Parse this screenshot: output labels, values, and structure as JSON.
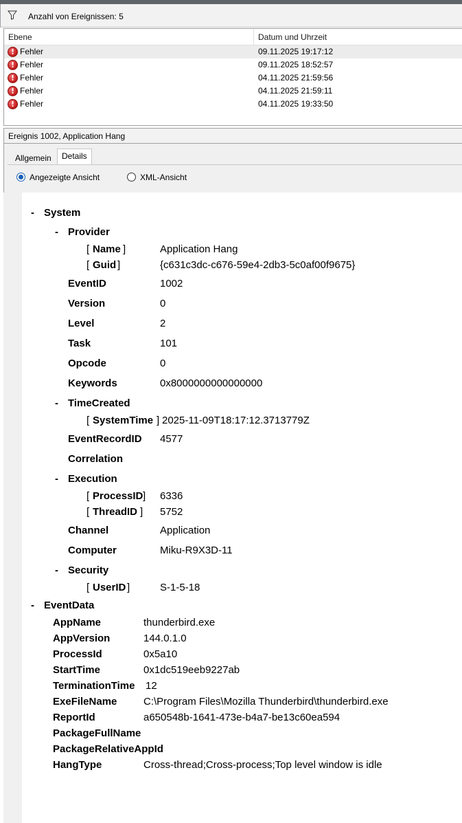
{
  "filter": {
    "count_label": "Anzahl von Ereignissen: 5"
  },
  "list": {
    "columns": [
      "Ebene",
      "Datum und Uhrzeit"
    ],
    "rows": [
      {
        "level": "Fehler",
        "datetime": "09.11.2025 19:17:12"
      },
      {
        "level": "Fehler",
        "datetime": "09.11.2025 18:52:57"
      },
      {
        "level": "Fehler",
        "datetime": "04.11.2025 21:59:56"
      },
      {
        "level": "Fehler",
        "datetime": "04.11.2025 21:59:11"
      },
      {
        "level": "Fehler",
        "datetime": "04.11.2025 19:33:50"
      }
    ]
  },
  "detail": {
    "title": "Ereignis 1002, Application Hang",
    "tabs": [
      "Allgemein",
      "Details"
    ],
    "views": [
      "Angezeigte Ansicht",
      "XML-Ansicht"
    ]
  },
  "event": {
    "system_label": "System",
    "provider_label": "Provider",
    "name_key": "Name",
    "name_val": "Application Hang",
    "guid_key": "Guid",
    "guid_val": "{c631c3dc-c676-59e4-2db3-5c0af00f9675}",
    "fields": [
      {
        "key": "EventID",
        "val": "1002"
      },
      {
        "key": "Version",
        "val": "0"
      },
      {
        "key": "Level",
        "val": "2"
      },
      {
        "key": "Task",
        "val": "101"
      },
      {
        "key": "Opcode",
        "val": "0"
      },
      {
        "key": "Keywords",
        "val": "0x8000000000000000"
      }
    ],
    "timecreated_label": "TimeCreated",
    "systemtime_key": "SystemTime",
    "systemtime_val": "2025-11-09T18:17:12.3713779Z",
    "eventrecordid_key": "EventRecordID",
    "eventrecordid_val": "4577",
    "correlation_label": "Correlation",
    "execution_label": "Execution",
    "processid_key": "ProcessID",
    "processid_val": "6336",
    "threadid_key": "ThreadID",
    "threadid_val": "5752",
    "channel_key": "Channel",
    "channel_val": "Application",
    "computer_key": "Computer",
    "computer_val": "Miku-R9X3D-11",
    "security_label": "Security",
    "userid_key": "UserID",
    "userid_val": "S-1-5-18",
    "eventdata_label": "EventData",
    "eventdata": [
      {
        "key": "AppName",
        "val": "thunderbird.exe"
      },
      {
        "key": "AppVersion",
        "val": "144.0.1.0"
      },
      {
        "key": "ProcessId",
        "val": "0x5a10"
      },
      {
        "key": "StartTime",
        "val": "0x1dc519eeb9227ab"
      },
      {
        "key": "TerminationTime",
        "val": "12"
      },
      {
        "key": "ExeFileName",
        "val": "C:\\Program Files\\Mozilla Thunderbird\\thunderbird.exe"
      },
      {
        "key": "ReportId",
        "val": "a650548b-1641-473e-b4a7-be13c60ea594"
      },
      {
        "key": "PackageFullName",
        "val": ""
      },
      {
        "key": "PackageRelativeAppId",
        "val": ""
      },
      {
        "key": "HangType",
        "val": "Cross-thread;Cross-process;Top level window is idle"
      }
    ]
  }
}
